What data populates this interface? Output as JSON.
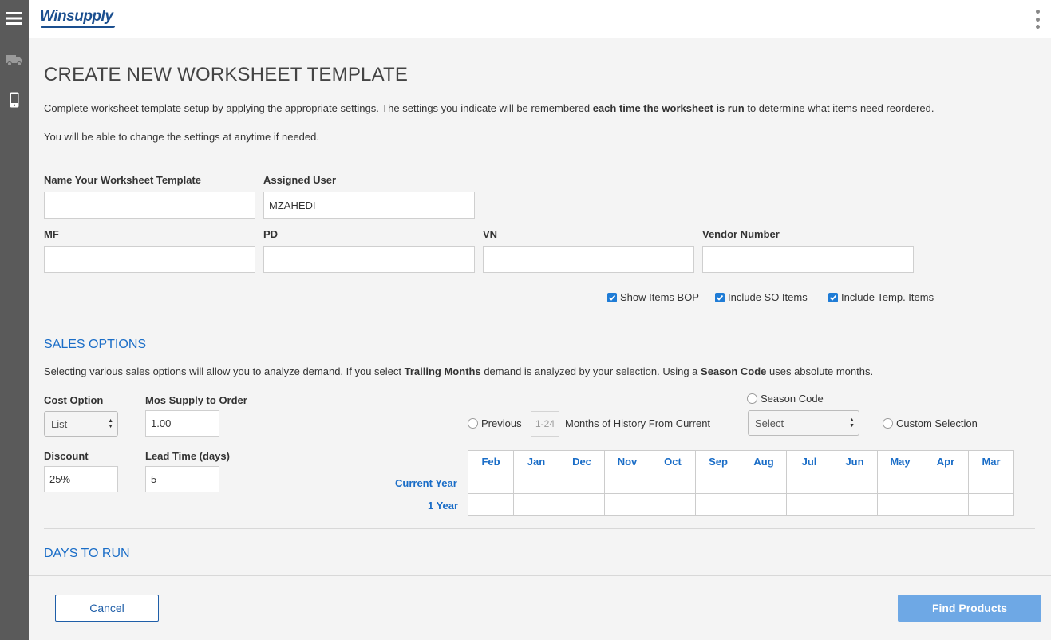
{
  "header": {
    "logo_text": "Winsupply"
  },
  "page": {
    "title": "CREATE NEW WORKSHEET TEMPLATE",
    "intro_1_pre": "Complete worksheet template setup by applying the appropriate settings.  The settings you indicate will be remembered ",
    "intro_1_bold": "each time the worksheet is run",
    "intro_1_post": " to determine what items need reordered.",
    "intro_2": "You will be able to change the settings at anytime if needed."
  },
  "form": {
    "name_label": "Name Your Worksheet Template",
    "name_value": "",
    "user_label": "Assigned User",
    "user_value": "MZAHEDI",
    "mf_label": "MF",
    "mf_value": "",
    "pd_label": "PD",
    "pd_value": "",
    "vn_label": "VN",
    "vn_value": "",
    "vendor_label": "Vendor Number",
    "vendor_value": "",
    "checkboxes": {
      "show_bop": "Show Items BOP",
      "include_so": "Include SO Items",
      "include_temp": "Include Temp. Items"
    }
  },
  "sales": {
    "heading": "SALES OPTIONS",
    "desc_pre": "Selecting various sales options will allow you to analyze demand.  If you select ",
    "desc_bold1": "Trailing Months",
    "desc_mid": " demand is analyzed by your selection. Using a ",
    "desc_bold2": "Season Code",
    "desc_post": " uses absolute months.",
    "cost_option_label": "Cost Option",
    "cost_option_value": "List",
    "mos_supply_label": "Mos Supply to Order",
    "mos_supply_value": "1.00",
    "discount_label": "Discount",
    "discount_value": "25%",
    "lead_time_label": "Lead Time (days)",
    "lead_time_value": "5",
    "season_code_label": "Season Code",
    "season_select_value": "Select",
    "previous_label": "Previous",
    "months_placeholder": "1-24",
    "months_history_label": "Months of History From Current",
    "custom_selection_label": "Custom Selection",
    "months": [
      "Feb",
      "Jan",
      "Dec",
      "Nov",
      "Oct",
      "Sep",
      "Aug",
      "Jul",
      "Jun",
      "May",
      "Apr",
      "Mar"
    ],
    "row_current": "Current Year",
    "row_one": "1 Year"
  },
  "days": {
    "heading": "DAYS TO RUN"
  },
  "buttons": {
    "cancel": "Cancel",
    "find": "Find Products"
  },
  "colors": {
    "accent": "#1a6dc7",
    "rail": "#5a5a5a",
    "find_button": "#6ea8e5"
  }
}
